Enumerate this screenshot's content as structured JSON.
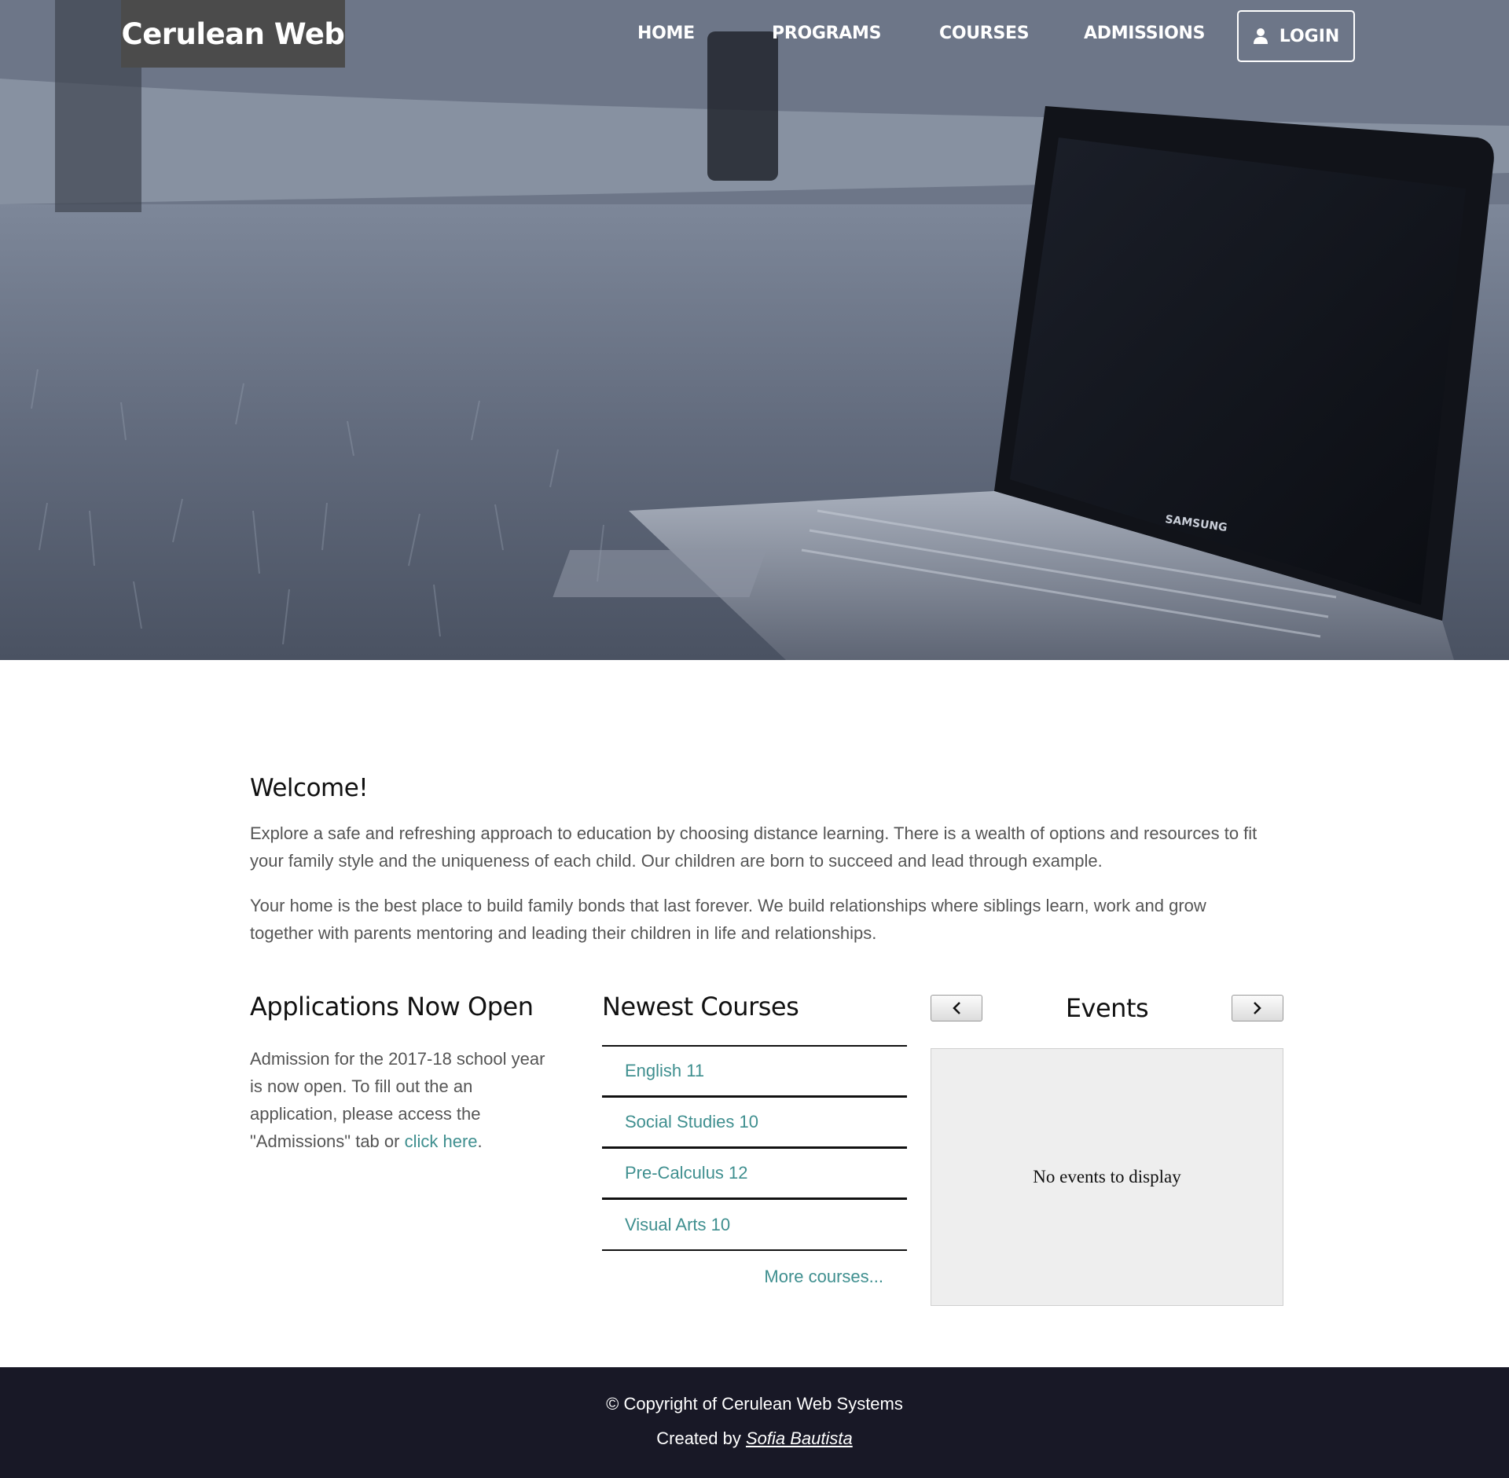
{
  "brand": {
    "name": "Cerulean Web"
  },
  "nav": {
    "items": [
      "HOME",
      "PROGRAMS",
      "COURSES",
      "ADMISSIONS"
    ],
    "login_label": "LOGIN"
  },
  "hero": {
    "laptop_brand": "SAMSUNG"
  },
  "welcome": {
    "title": "Welcome!",
    "paragraphs": [
      "Explore a safe and refreshing approach to education by choosing distance learning. There is a wealth of options and resources to fit your family style and the uniqueness of each child. Our children are born to succeed and lead through example.",
      "Your home is the best place to build family bonds that last forever. We build relationships where siblings learn, work and grow together with parents mentoring and leading their children in life and relationships."
    ]
  },
  "applications": {
    "title": "Applications Now Open",
    "text_before": "Admission for the 2017-18 school year is now open. To fill out the an application, please access the \"Admissions\" tab or ",
    "link_text": "click here",
    "text_after": "."
  },
  "courses": {
    "title": "Newest Courses",
    "items": [
      "English 11",
      "Social Studies 10",
      "Pre-Calculus 12",
      "Visual Arts 10"
    ],
    "more_label": "More courses..."
  },
  "events": {
    "title": "Events",
    "empty_message": "No events to display"
  },
  "footer": {
    "copyright": "© Copyright of Cerulean Web Systems",
    "created_by_prefix": "Created by ",
    "author": "Sofia Bautista"
  },
  "colors": {
    "link": "#3f8f8f",
    "footer_bg": "#181826",
    "brand_bg": "#4b4b4b"
  }
}
